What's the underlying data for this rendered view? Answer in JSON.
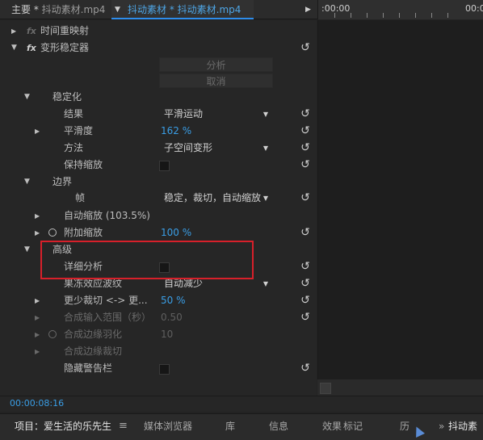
{
  "header": {
    "main_tab": "主要 * ",
    "main_tab_clip": "抖动素材.mp4",
    "dropdown_arrow": "▼",
    "clip_tab": "抖动素材 * 抖动素材.mp4",
    "more_arrow": "▶"
  },
  "timeline": {
    "ruler_start": ":00:00",
    "ruler_end": "00:0"
  },
  "effects": {
    "time_remap": {
      "label": "时间重映射",
      "fx": "fx"
    },
    "warp_stabilizer": {
      "label": "变形稳定器",
      "fx": "fx"
    },
    "analyze_label": "分析",
    "cancel_label": "取消",
    "stabilization": {
      "label": "稳定化",
      "result_label": "结果",
      "result_value": "平滑运动",
      "smoothness_label": "平滑度",
      "smoothness_value": "162 %",
      "method_label": "方法",
      "method_value": "子空间变形",
      "preserve_scale_label": "保持缩放"
    },
    "borders": {
      "label": "边界",
      "frame_label": "帧",
      "frame_value": "稳定，裁切，自动缩放",
      "auto_scale_label": "自动缩放 (103.5%)",
      "additional_scale_label": "附加缩放",
      "additional_scale_value": "100 %"
    },
    "advanced": {
      "label": "高级",
      "detailed_analysis_label": "详细分析",
      "rolling_shutter_label": "果冻效应波纹",
      "rolling_shutter_value": "自动减少",
      "crop_less_label": "更少裁切 <-> 更...",
      "crop_less_value": "50 %",
      "synth_input_label": "合成输入范围（秒）",
      "synth_input_value": "0.50",
      "synth_feather_label": "合成边缘羽化",
      "synth_feather_value": "10",
      "synth_crop_label": "合成边缘裁切",
      "hide_warning_label": "隐藏警告栏"
    }
  },
  "status": {
    "timecode": "00:00:08:16"
  },
  "bottom_tabs": {
    "project": "项目：爱生活的乐先生",
    "menu_icon": "≡",
    "media_browser": "媒体浏览器",
    "library": "库",
    "info": "信息",
    "effects": "效果",
    "markers": "标记",
    "history": "历",
    "extra": "»",
    "clip": "抖动素"
  },
  "colors": {
    "accent_blue": "#3a9ee6",
    "highlight_red": "#d7202a",
    "background": "#232323"
  }
}
